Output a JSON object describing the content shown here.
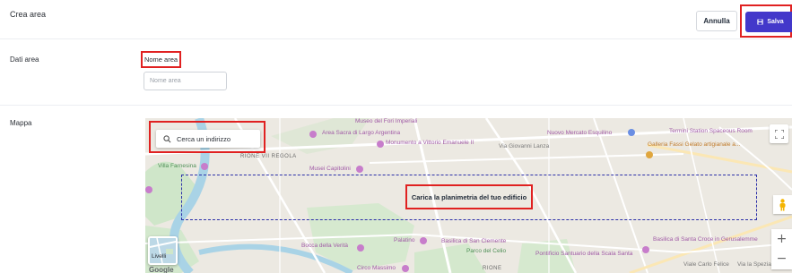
{
  "header": {
    "title": "Crea area",
    "cancel_label": "Annulla",
    "save_label": "Salva"
  },
  "area_section": {
    "label": "Dati area",
    "field_label": "Nome area",
    "field_placeholder": "Nome area",
    "field_value": ""
  },
  "map_section": {
    "label": "Mappa",
    "search_placeholder": "Cerca un indirizzo",
    "upload_label": "Carica la planimetria del tuo edificio",
    "layers_label": "Livelli",
    "google_label": "Google",
    "zoom_in": "+",
    "zoom_out": "−"
  },
  "map_labels": {
    "museo": "Museo del Fori Imperiali",
    "area_sacra": "Area Sacra di Largo Argentina",
    "monumento": "Monumento a Vittorio Emanuele II",
    "mercato": "Nuovo Mercato Esquilino",
    "termini": "Termini Station Spaceous Room",
    "galleria": "Galleria Fassi Gelato artigianale a...",
    "villa": "Villa Farnesina",
    "rione": "RIONE VII REGOLA",
    "capitolini": "Musei Capitolini",
    "via_lanza": "Via Giovanni Lanza",
    "bocca": "Bocca della Verità",
    "palatino": "Palatino",
    "clemente": "Basilica di San Clemente",
    "celio": "Parco del Celio",
    "santa_croce": "Basilica di Santa Croce in Gerusalemme",
    "pontificio": "Pontificio Santuario della Scala Santa",
    "circo": "Circo Massimo",
    "carlo_felice": "Viale Carlo Felice",
    "spezia": "Via la Spezia",
    "rione2": "RIONE"
  },
  "colors": {
    "primary": "#4338ca",
    "highlight": "#e02121",
    "map_bg": "#ebe8e1"
  }
}
